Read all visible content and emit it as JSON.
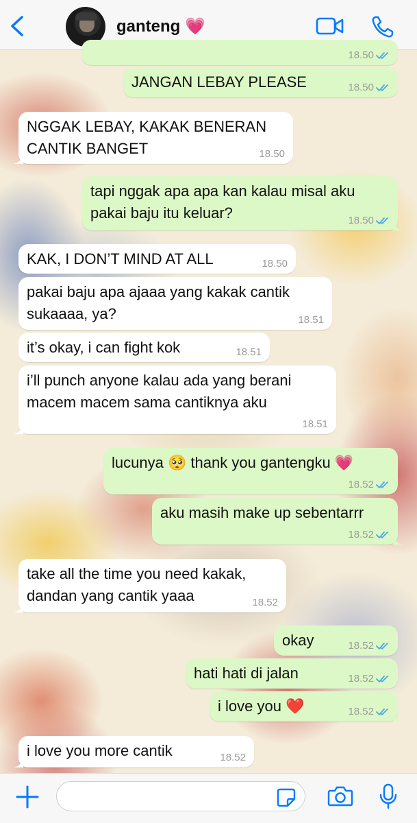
{
  "header": {
    "back_label": "back",
    "contact_name": "ganteng 💗"
  },
  "messages": [
    {
      "dir": "out",
      "text": "",
      "time": "18.50",
      "ticks": true
    },
    {
      "dir": "out",
      "text": "JANGAN LEBAY PLEASE",
      "time": "18.50",
      "ticks": true
    },
    {
      "dir": "in",
      "text": "NGGAK LEBAY, KAKAK BENERAN\nCANTIK BANGET",
      "time": "18.50"
    },
    {
      "dir": "out",
      "text": "tapi nggak apa apa kan kalau misal aku\npakai baju itu keluar?",
      "time": "18.50",
      "ticks": true
    },
    {
      "dir": "in",
      "text": "KAK, I DON’T MIND AT ALL",
      "time": "18.50"
    },
    {
      "dir": "in",
      "text": "pakai baju apa ajaaa yang kakak cantik\nsukaaaa, ya?",
      "time": "18.51"
    },
    {
      "dir": "in",
      "text": "it’s okay, i can fight kok",
      "time": "18.51"
    },
    {
      "dir": "in",
      "text": "i’ll punch anyone kalau ada yang berani\nmacem macem sama cantiknya aku",
      "time": "18.51"
    },
    {
      "dir": "out",
      "text": "lucunya 🥺 thank you gantengku 💗",
      "time": "18.52",
      "ticks": true
    },
    {
      "dir": "out",
      "text": "aku masih make up sebentarrr",
      "time": "18.52",
      "ticks": true
    },
    {
      "dir": "in",
      "text": "take all the time you need kakak,\ndandan yang cantik yaaa",
      "time": "18.52"
    },
    {
      "dir": "out",
      "text": "okay",
      "time": "18.52",
      "ticks": true
    },
    {
      "dir": "out",
      "text": "hati hati di jalan",
      "time": "18.52",
      "ticks": true
    },
    {
      "dir": "out",
      "text": "i love you ❤️",
      "time": "18.52",
      "ticks": true
    },
    {
      "dir": "in",
      "text": "i love you more cantik",
      "time": "18.52"
    }
  ],
  "input": {
    "placeholder": "",
    "value": ""
  },
  "colors": {
    "accent": "#007aff",
    "outgoing_bubble": "#dcf8c6",
    "incoming_bubble": "#ffffff",
    "read_ticks": "#4fa7e3"
  },
  "icons": [
    "chevron-left-icon",
    "video-call-icon",
    "phone-icon",
    "plus-icon",
    "sticker-icon",
    "camera-icon",
    "microphone-icon",
    "double-check-icon"
  ]
}
